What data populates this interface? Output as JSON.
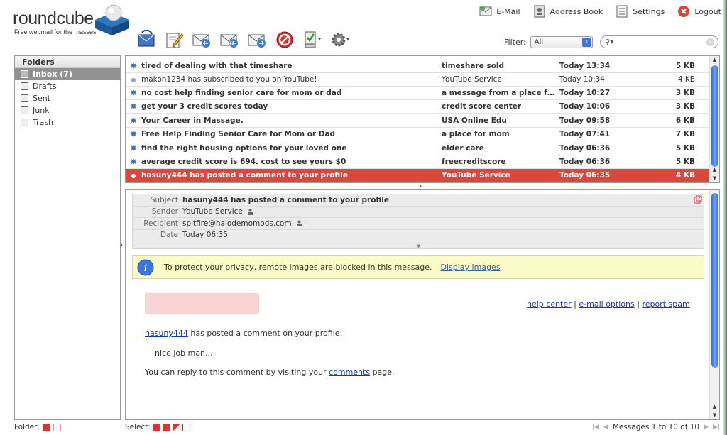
{
  "brand": {
    "name": "roundcube",
    "tagline": "Free webmail for the masses"
  },
  "topnav": [
    {
      "label": "E-Mail",
      "icon": "mail-icon"
    },
    {
      "label": "Address Book",
      "icon": "address-book-icon"
    },
    {
      "label": "Settings",
      "icon": "settings-icon"
    },
    {
      "label": "Logout",
      "icon": "logout-icon"
    }
  ],
  "filter": {
    "label": "Filter:",
    "value": "All"
  },
  "search": {
    "placeholder": ""
  },
  "folders": {
    "title": "Folders",
    "items": [
      {
        "label": "Inbox (7)",
        "selected": true
      },
      {
        "label": "Drafts"
      },
      {
        "label": "Sent"
      },
      {
        "label": "Junk"
      },
      {
        "label": "Trash"
      }
    ]
  },
  "messages": [
    {
      "subject": "tired of dealing with that timeshare",
      "from": "timeshare sold",
      "date": "Today 13:34",
      "size": "5 KB",
      "unread": true
    },
    {
      "subject": "makoh1234 has subscribed to you on YouTube!",
      "from": "YouTube Service",
      "date": "Today 10:34",
      "size": "4 KB",
      "unread": false
    },
    {
      "subject": "no cost help finding senior care for mom or dad",
      "from": "a message from a place for…",
      "date": "Today 10:27",
      "size": "3 KB",
      "unread": true
    },
    {
      "subject": "get your 3 credit scores today",
      "from": "credit score center",
      "date": "Today 10:06",
      "size": "3 KB",
      "unread": true
    },
    {
      "subject": "Your Career in Massage.",
      "from": "USA Online Edu",
      "date": "Today 09:58",
      "size": "6 KB",
      "unread": true
    },
    {
      "subject": "Free Help Finding Senior Care for Mom or Dad",
      "from": "a place for mom",
      "date": "Today 07:41",
      "size": "7 KB",
      "unread": true
    },
    {
      "subject": "find the right housing options for your loved one",
      "from": "elder care",
      "date": "Today 06:36",
      "size": "5 KB",
      "unread": true
    },
    {
      "subject": "average credit score is 694. cost to see yours $0",
      "from": "freecreditscore",
      "date": "Today 06:36",
      "size": "5 KB",
      "unread": true
    },
    {
      "subject": "hasuny444 has posted a comment to your profile",
      "from": "YouTube Service",
      "date": "Today 06:35",
      "size": "4 KB",
      "unread": false,
      "selected": true
    }
  ],
  "preview": {
    "headers": {
      "subject_label": "Subject",
      "subject": "hasuny444 has posted a comment to your profile",
      "sender_label": "Sender",
      "sender": "YouTube Service",
      "recipient_label": "Recipient",
      "recipient": "spitfire@halodemomods.com",
      "date_label": "Date",
      "date": "Today 06:35"
    },
    "notice": {
      "text": "To protect your privacy, remote images are blocked in this message.",
      "link": "Display images"
    },
    "links": {
      "help": "help center",
      "sep1": "|",
      "options": "e-mail options",
      "sep2": "|",
      "spam": "report spam"
    },
    "body": {
      "user": "hasuny444",
      "line1": " has posted a comment on your profile:",
      "comment": "nice job man...",
      "reply_prefix": "You can reply to this comment by visiting your ",
      "reply_link": "comments",
      "reply_suffix": " page."
    }
  },
  "footer": {
    "folder_label": "Folder:",
    "select_label": "Select:",
    "count": "Messages 1 to 10 of 10"
  },
  "colors": {
    "selected_row": "#d9483b",
    "accent": "#3c6fd1",
    "notice_bg": "#fbfbc8"
  }
}
